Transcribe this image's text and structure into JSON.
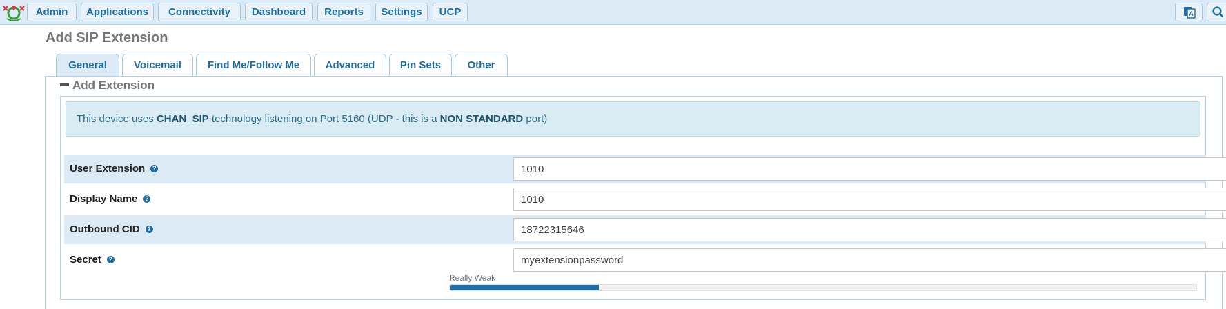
{
  "nav": {
    "items": [
      "Admin",
      "Applications",
      "Connectivity",
      "Dashboard",
      "Reports",
      "Settings",
      "UCP"
    ],
    "right_icons": [
      "language-icon",
      "search-icon"
    ]
  },
  "page": {
    "title": "Add SIP Extension"
  },
  "tabs": [
    "General",
    "Voicemail",
    "Find Me/Follow Me",
    "Advanced",
    "Pin Sets",
    "Other"
  ],
  "active_tab": "General",
  "section": {
    "title": "Add Extension"
  },
  "alert": {
    "prefix": "This device uses ",
    "tech": "CHAN_SIP",
    "middle": " technology listening on Port 5160 (UDP - this is a ",
    "emphasis": "NON STANDARD",
    "suffix": " port)"
  },
  "fields": [
    {
      "label": "User Extension",
      "value": "1010"
    },
    {
      "label": "Display Name",
      "value": "1010"
    },
    {
      "label": "Outbound CID",
      "value": "18722315646"
    },
    {
      "label": "Secret",
      "value": "myextensionpassword"
    }
  ],
  "password_strength": {
    "label": "Really Weak",
    "level": 0.2
  },
  "colors": {
    "nav_bg": "#dbeaf5",
    "accent": "#1e6fa6",
    "alert_bg": "#d9ecf4"
  }
}
